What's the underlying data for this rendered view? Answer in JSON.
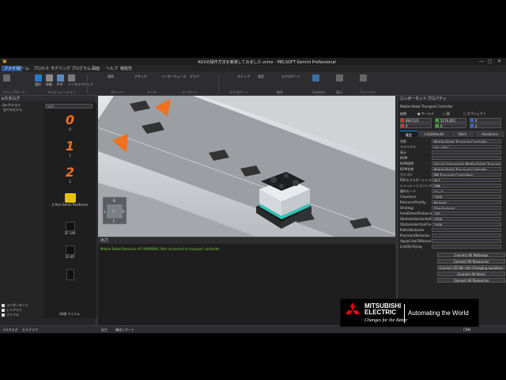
{
  "window": {
    "title": "AGVの操作方法を実演してみました.vcmx - MELSOFT Gemini Professional"
  },
  "menu": [
    "ファイル",
    "ホーム",
    "プロセス",
    "モデリング",
    "プログラム",
    "図面",
    "ヘルプ",
    "機能性"
  ],
  "ribbon": {
    "items": [
      "選択",
      "移動",
      "PnP",
      "インタラクティブ",
      "接続",
      "アタッチ",
      "インターフェース",
      "グラフ",
      "ステップ",
      "測定",
      "エクスポート"
    ],
    "groups": [
      "クリップボード",
      "マニピュレーション",
      "グリッド",
      "ツール",
      "インポート",
      "エクスポート",
      "統合",
      "Camera",
      "表示",
      "ウィンドウ"
    ]
  },
  "catalog": {
    "title": "eカタログ",
    "collections_label": "コレクション",
    "search_placeholder": "検索",
    "tree": [
      "全てのモデル",
      "最近使用した",
      "Components",
      "Layouts",
      "マイモデル",
      "既定のモデル",
      "公式の新しい",
      "最近のレイアウト",
      "タイプ別モデル",
      "Basic Shapes",
      "Cameras",
      "Characters",
      "Conveyor Acc",
      "Conveyors",
      "Conveyors",
      "Facilities - Fe",
      "Facilities - Fo",
      "Facilities - Ot",
      "Feeders",
      "Layout Temp",
      "Life Sciences",
      "Machine Acc",
      "Machines",
      "Misc",
      "Packaging Li",
      "Physics",
      "Pick and Pla",
      "PM Covers",
      "PM Mobile R",
      "PM Mobile R",
      "PM Mobile R",
      "PM Mobile R",
      "PM Process",
      "Robot Positio"
    ],
    "gallery": [
      {
        "label": "0",
        "caption": "0"
      },
      {
        "label": "1",
        "caption": "1"
      },
      {
        "label": "2",
        "caption": "2"
      },
      {
        "label": "",
        "caption": "2-Axis Servo Positioner"
      },
      {
        "label": "",
        "caption": "2F-140"
      },
      {
        "label": "",
        "caption": "2F-85"
      }
    ],
    "item_count": "28項 アイテム",
    "checks": [
      "コンポーネント",
      "レイアウト",
      "ファイル"
    ]
  },
  "output": {
    "title": "出力",
    "message": "Mobile Robot Resource #2 WARNING: Not connected to transport controller"
  },
  "bottom_tabs": [
    "eカタログ",
    "セルグラフ",
    "出力",
    "構成レポート"
  ],
  "props": {
    "title": "コンポーネントプロパティ",
    "subtitle": "Mobile Robot Transport Controller",
    "coord_label": "座標",
    "coord_world": "ワールド",
    "coord_parent": "親",
    "coord_object": "オブジェクト",
    "x": "890.523",
    "y": "5270.852",
    "z": "0",
    "rx": "0",
    "ry": "0",
    "rz": "0",
    "tabs": [
      "既定",
      "LinkDefaults",
      "Work",
      "Avoidance"
    ],
    "rows": [
      {
        "label": "名前",
        "value": "Mobile Robot Transport Controller"
      },
      {
        "label": "マテリアル",
        "value": "ypr_color"
      },
      {
        "label": "表示",
        "value": ""
      },
      {
        "label": "BOM",
        "value": ""
      },
      {
        "label": "BOM説明",
        "value": "Visual Components Mobile Robot Transport Co"
      },
      {
        "label": "BOM名称",
        "value": "Mobile Robot Transport Controller"
      },
      {
        "label": "カテゴリ",
        "value": "PM Transport Controllers"
      },
      {
        "label": "PDFエクスポートレベル",
        "value": "完了"
      },
      {
        "label": "シミュレーションレベル",
        "value": "詳細"
      },
      {
        "label": "操作モード",
        "value": "ワーク"
      },
      {
        "label": "Clearance",
        "value": "1000"
      },
      {
        "label": "ResourcePriority",
        "value": "Nearest"
      },
      {
        "label": "Strategy",
        "value": "One-to-many"
      },
      {
        "label": "AreaDetectDistance",
        "value": "100"
      },
      {
        "label": "ObstacleHorizontalC",
        "value": "1000"
      },
      {
        "label": "ObstacleVerticalCle",
        "value": "1000"
      },
      {
        "label": "PathsObstacles",
        "value": ""
      },
      {
        "label": "PrecisionObstacles",
        "value": ""
      },
      {
        "label": "ApplyColorToResour",
        "value": ""
      },
      {
        "label": "LimitOnFlying",
        "value": ""
      }
    ],
    "buttons": [
      "Connect All Pathways",
      "Connect All Resources",
      "Connect 2D Win-Ant Changing Locations",
      "Connect All Items",
      "Connect All Resources"
    ],
    "units": "mm",
    "status": "CNM"
  },
  "logo": {
    "brand_line1": "MITSUBISHI",
    "brand_line2": "ELECTRIC",
    "slogan": "Changes for the Better",
    "tagline": "Automating the World"
  },
  "colors": {
    "accent": "#f07020",
    "selection": "#094771",
    "ok_text": "#7ac943"
  }
}
